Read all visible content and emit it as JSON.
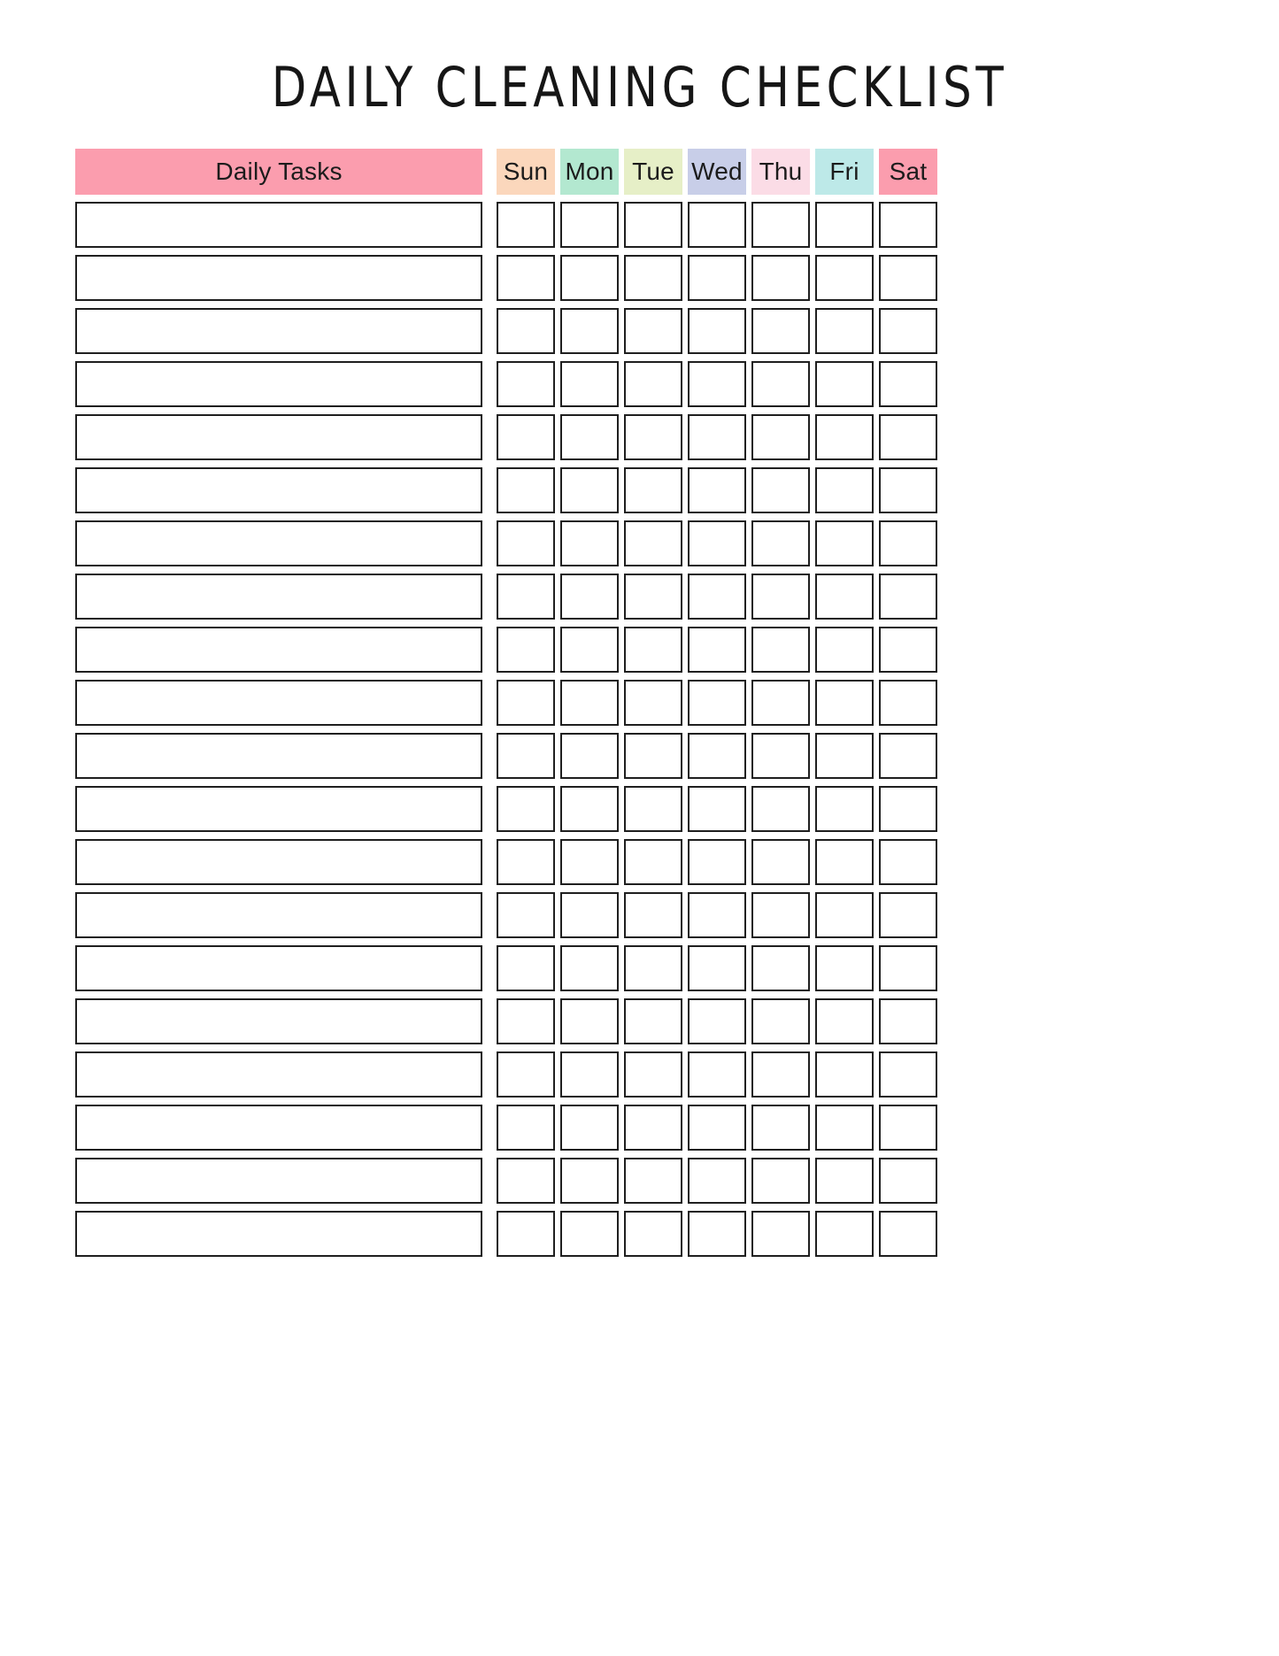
{
  "page": {
    "title": "DAILY CLEANING CHECKLIST",
    "background": "#ffffff"
  },
  "table": {
    "tasks_header": {
      "label": "Daily Tasks",
      "color": "#fb9dae"
    },
    "days": [
      {
        "label": "Sun",
        "color": "#fbd7bc"
      },
      {
        "label": "Mon",
        "color": "#b3e8d0"
      },
      {
        "label": "Tue",
        "color": "#e6efc7"
      },
      {
        "label": "Wed",
        "color": "#c8cee8"
      },
      {
        "label": "Thu",
        "color": "#fbdce6"
      },
      {
        "label": "Fri",
        "color": "#bde9e8"
      },
      {
        "label": "Sat",
        "color": "#fb9dae"
      }
    ],
    "row_count": 20,
    "rows": [
      {
        "task": ""
      },
      {
        "task": ""
      },
      {
        "task": ""
      },
      {
        "task": ""
      },
      {
        "task": ""
      },
      {
        "task": ""
      },
      {
        "task": ""
      },
      {
        "task": ""
      },
      {
        "task": ""
      },
      {
        "task": ""
      },
      {
        "task": ""
      },
      {
        "task": ""
      },
      {
        "task": ""
      },
      {
        "task": ""
      },
      {
        "task": ""
      },
      {
        "task": ""
      },
      {
        "task": ""
      },
      {
        "task": ""
      },
      {
        "task": ""
      },
      {
        "task": ""
      }
    ],
    "border_color": "#1f1f1f"
  }
}
